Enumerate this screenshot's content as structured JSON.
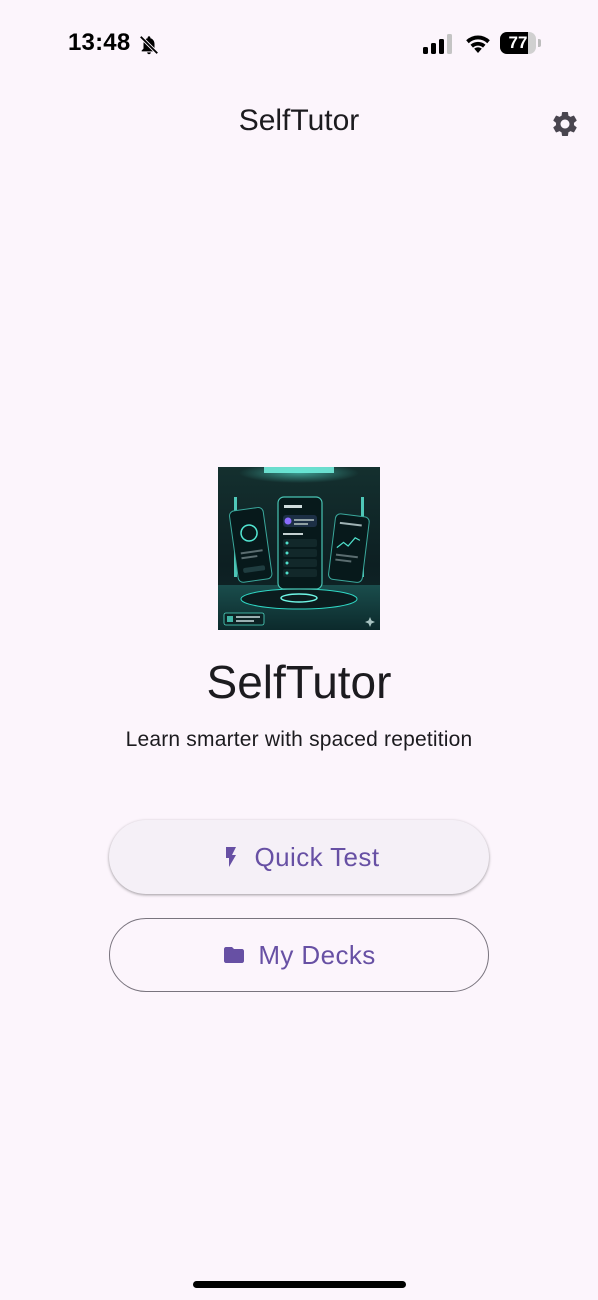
{
  "status_bar": {
    "time": "13:48",
    "battery_level": "77",
    "battery_fraction": 0.77,
    "icons": [
      "bell-muted-icon",
      "signal-icon",
      "wifi-icon",
      "battery-icon"
    ]
  },
  "app_bar": {
    "title": "SelfTutor",
    "settings_icon": "gear-icon"
  },
  "hero": {
    "title": "SelfTutor",
    "subtitle": "Learn smarter with spaced repetition",
    "image_icon": "app-promo-image"
  },
  "actions": {
    "quick_test_label": "Quick Test",
    "quick_test_icon": "bolt-icon",
    "my_decks_label": "My Decks",
    "my_decks_icon": "folder-icon"
  },
  "colors": {
    "background": "#fcf5fc",
    "primary": "#6750a4",
    "outline": "#79747e",
    "on_surface": "#1c1b1f"
  }
}
